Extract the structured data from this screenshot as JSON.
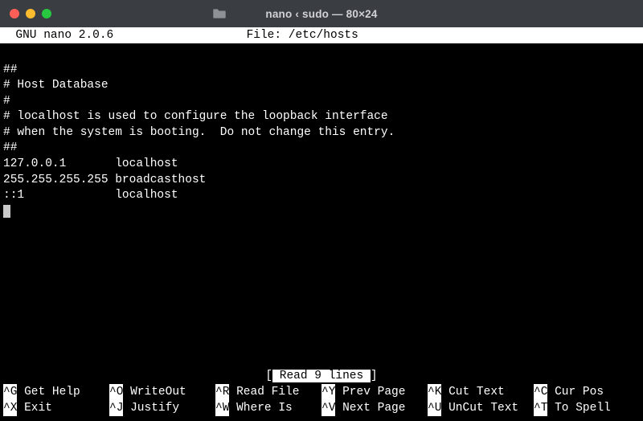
{
  "window": {
    "title": "nano ‹ sudo — 80×24"
  },
  "header": {
    "left": "  GNU nano 2.0.6",
    "center_label": "File:",
    "filename": "/etc/hosts"
  },
  "editor": {
    "lines": [
      "##",
      "# Host Database",
      "#",
      "# localhost is used to configure the loopback interface",
      "# when the system is booting.  Do not change this entry.",
      "##",
      "127.0.0.1       localhost",
      "255.255.255.255 broadcasthost",
      "::1             localhost"
    ]
  },
  "status": {
    "message": " Read 9 lines "
  },
  "shortcuts": {
    "row1": [
      {
        "key": "^G",
        "label": " Get Help"
      },
      {
        "key": "^O",
        "label": " WriteOut"
      },
      {
        "key": "^R",
        "label": " Read File"
      },
      {
        "key": "^Y",
        "label": " Prev Page"
      },
      {
        "key": "^K",
        "label": " Cut Text"
      },
      {
        "key": "^C",
        "label": " Cur Pos"
      }
    ],
    "row2": [
      {
        "key": "^X",
        "label": " Exit"
      },
      {
        "key": "^J",
        "label": " Justify"
      },
      {
        "key": "^W",
        "label": " Where Is"
      },
      {
        "key": "^V",
        "label": " Next Page"
      },
      {
        "key": "^U",
        "label": " UnCut Text"
      },
      {
        "key": "^T",
        "label": " To Spell"
      }
    ]
  }
}
